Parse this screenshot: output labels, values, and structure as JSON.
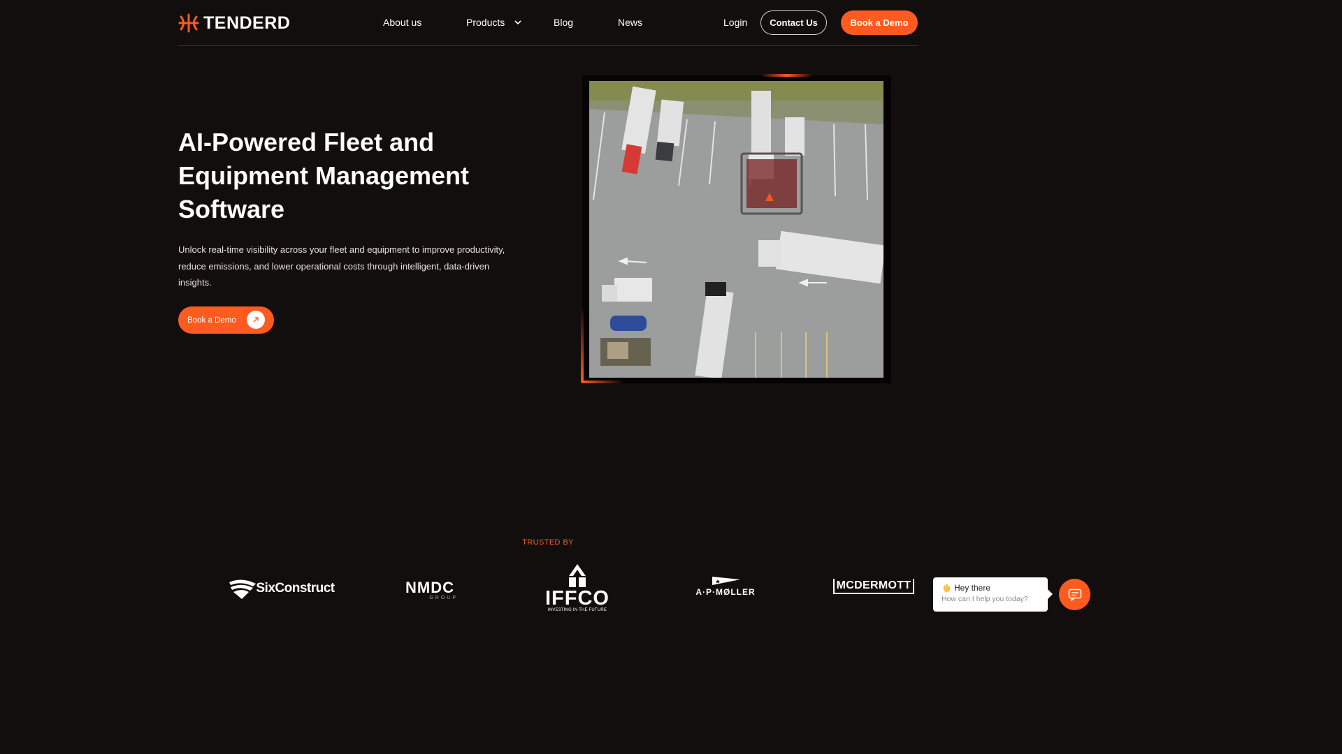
{
  "brand": {
    "name": "TENDERD",
    "accent": "#ff5a1f"
  },
  "nav": {
    "links": [
      {
        "label": "About us"
      },
      {
        "label": "Products"
      },
      {
        "label": "Blog"
      },
      {
        "label": "News"
      }
    ],
    "login": "Login",
    "contact": "Contact Us",
    "book_demo": "Book a Demo"
  },
  "hero": {
    "title": "AI-Powered Fleet and Equipment Management Software",
    "subtitle": "Unlock real-time visibility across your fleet and equipment to improve productivity, reduce emissions, and lower operational costs through intelligent, data-driven insights.",
    "cta": "Book a Demo"
  },
  "trusted": {
    "label": "TRUSTED BY",
    "clients": [
      {
        "name": "SixConstruct"
      },
      {
        "name": "NMDC",
        "tagline": "GROUP"
      },
      {
        "name": "IFFCO",
        "tagline": "INVESTING IN THE FUTURE"
      },
      {
        "name": "A·P·MØLLER"
      },
      {
        "name": "MCDERMOTT"
      }
    ]
  },
  "chat": {
    "title": "Hey there",
    "subtitle": "How can I help you today?"
  }
}
